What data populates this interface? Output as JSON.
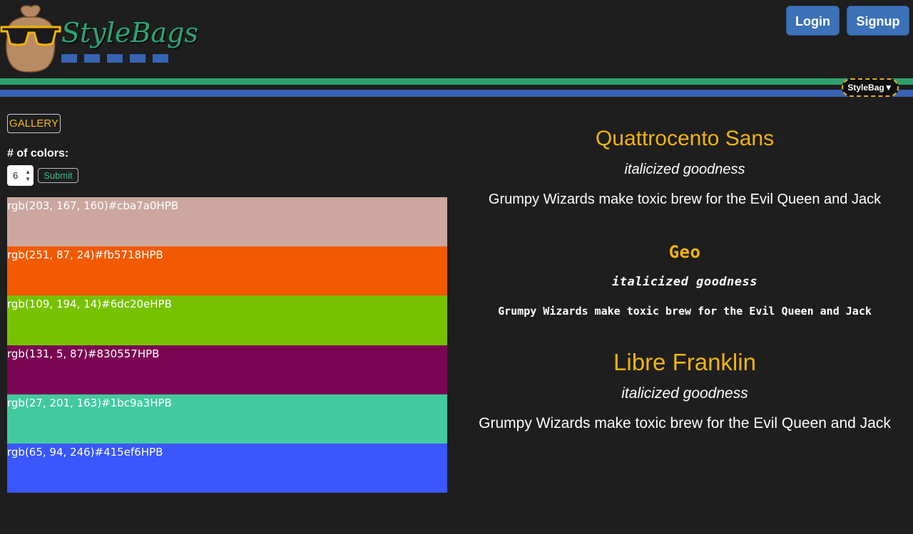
{
  "header": {
    "logo_text": "StyleBags",
    "login_label": "Login",
    "signup_label": "Signup",
    "stylebag_menu_label": "StyleBag▼"
  },
  "sidebar": {
    "gallery_label": "GALLERY",
    "colors_label": "# of colors:",
    "color_count": "6",
    "submit_label": "Submit"
  },
  "swatches": [
    {
      "label": "rgb(203, 167, 160)#cba7a0HPB",
      "color": "#cba7a0"
    },
    {
      "label": "rgb(251, 87, 24)#fb5718HPB",
      "color": "#f25a00"
    },
    {
      "label": "rgb(109, 194, 14)#6dc20eHPB",
      "color": "#77c200"
    },
    {
      "label": "rgb(131, 5, 87)#830557HPB",
      "color": "#7a0552"
    },
    {
      "label": "rgb(27, 201, 163)#1bc9a3HPB",
      "color": "#43c9a0"
    },
    {
      "label": "rgb(65, 94, 246)#415ef6HPB",
      "color": "#3a57fb"
    }
  ],
  "fonts": [
    {
      "name": "Quattrocento Sans",
      "italic": "italicized goodness",
      "sample": "Grumpy Wizards make toxic brew for the Evil Queen and Jack"
    },
    {
      "name": "Geo",
      "italic": "italicized goodness",
      "sample": "Grumpy Wizards make toxic brew for the Evil Queen and Jack"
    },
    {
      "name": "Libre Franklin",
      "italic": "italicized goodness",
      "sample": "Grumpy Wizards make toxic brew for the Evil Queen and Jack"
    }
  ],
  "colors": {
    "background": "#1e1e1e",
    "accent_yellow": "#f1b40c",
    "stripe_green": "#2fa16e",
    "stripe_blue": "#3b63b3",
    "button_blue": "#3d72b8"
  }
}
